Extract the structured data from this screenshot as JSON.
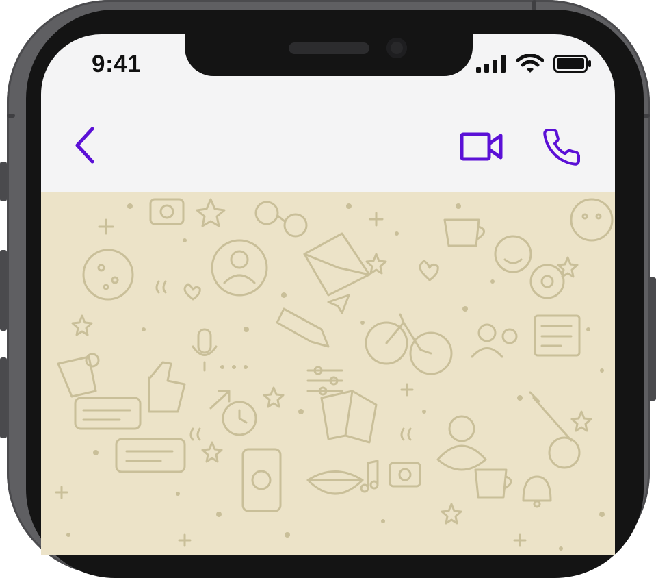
{
  "status_bar": {
    "time": "9:41",
    "icons": [
      "cellular-signal-icon",
      "wifi-icon",
      "battery-icon"
    ]
  },
  "nav_bar": {
    "back_icon": "chevron-left-icon",
    "actions": [
      "video-camera-icon",
      "phone-icon"
    ]
  },
  "chat": {
    "wallpaper": "doodle-pattern"
  },
  "colors": {
    "accent": "#5b10d6",
    "nav_background": "#f4f4f5",
    "wallpaper_base": "#ece3c8",
    "wallpaper_doodle": "#c9bf99",
    "device_frame": "#5f5f62",
    "bezel": "#141414"
  }
}
